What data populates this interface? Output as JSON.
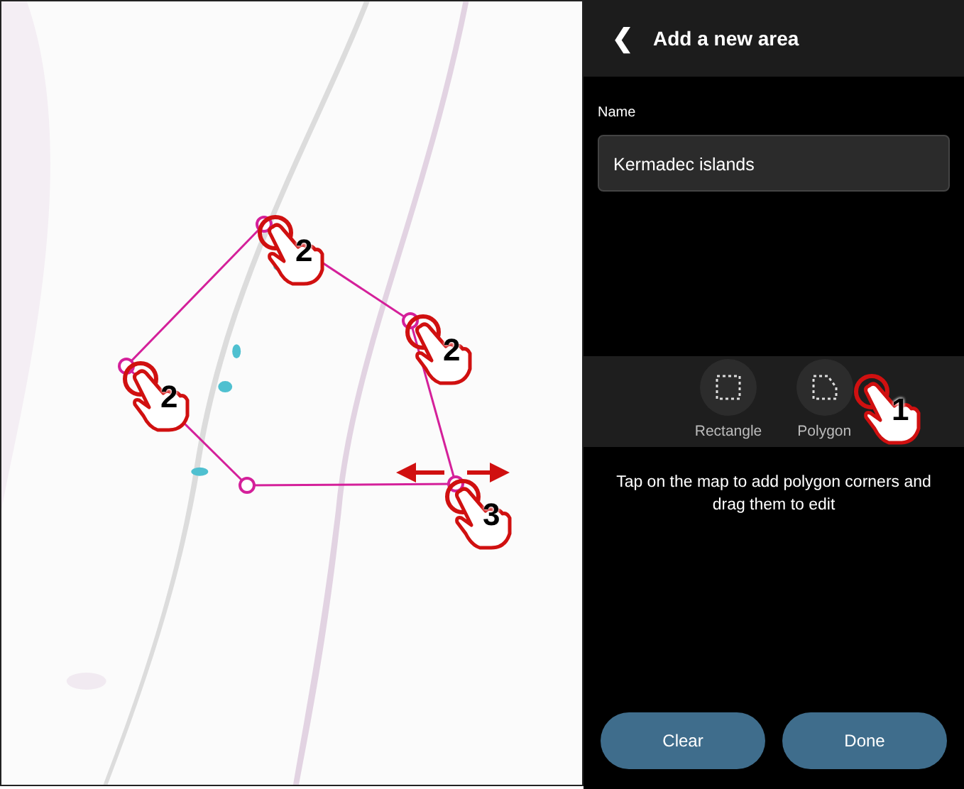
{
  "header": {
    "back": "❮",
    "title": "Add a new area"
  },
  "name_field": {
    "label": "Name",
    "value": "Kermadec islands"
  },
  "tools": [
    {
      "label": "Rectangle",
      "kind": "rectangle"
    },
    {
      "label": "Polygon",
      "kind": "polygon"
    }
  ],
  "hint": "Tap on the map to add polygon corners and drag them to edit",
  "buttons": [
    "Clear",
    "Done"
  ],
  "callouts": [
    {
      "label": "2"
    },
    {
      "label": "2"
    },
    {
      "label": "2"
    },
    {
      "label": "3"
    },
    {
      "label": "1"
    }
  ]
}
